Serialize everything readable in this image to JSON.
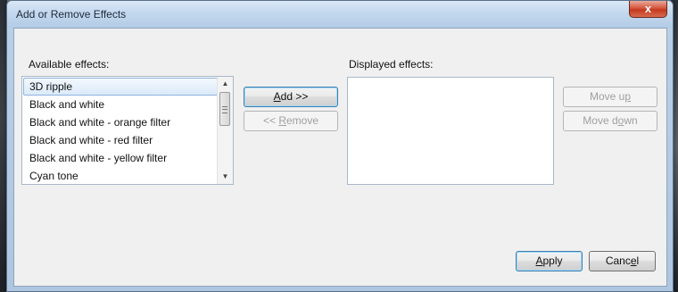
{
  "window": {
    "title": "Add or Remove Effects",
    "close_glyph": "x"
  },
  "available": {
    "label": "Available effects:",
    "items": [
      "3D ripple",
      "Black and white",
      "Black and white - orange filter",
      "Black and white - red filter",
      "Black and white - yellow filter",
      "Cyan tone"
    ],
    "selected_index": 0
  },
  "displayed": {
    "label": "Displayed effects:",
    "items": []
  },
  "buttons": {
    "add": {
      "pre": "",
      "mnemonic": "A",
      "post": "dd >>"
    },
    "remove": {
      "pre": "<< ",
      "mnemonic": "R",
      "post": "emove"
    },
    "move_up": {
      "pre": "Move u",
      "mnemonic": "p",
      "post": ""
    },
    "move_down": {
      "pre": "Move d",
      "mnemonic": "o",
      "post": "wn"
    },
    "apply": {
      "pre": "",
      "mnemonic": "A",
      "post": "pply"
    },
    "cancel": {
      "pre": "Canc",
      "mnemonic": "e",
      "post": "l"
    }
  },
  "icons": {
    "close": "close-icon",
    "scroll_up": "scroll-up-icon",
    "scroll_down": "scroll-down-icon"
  }
}
